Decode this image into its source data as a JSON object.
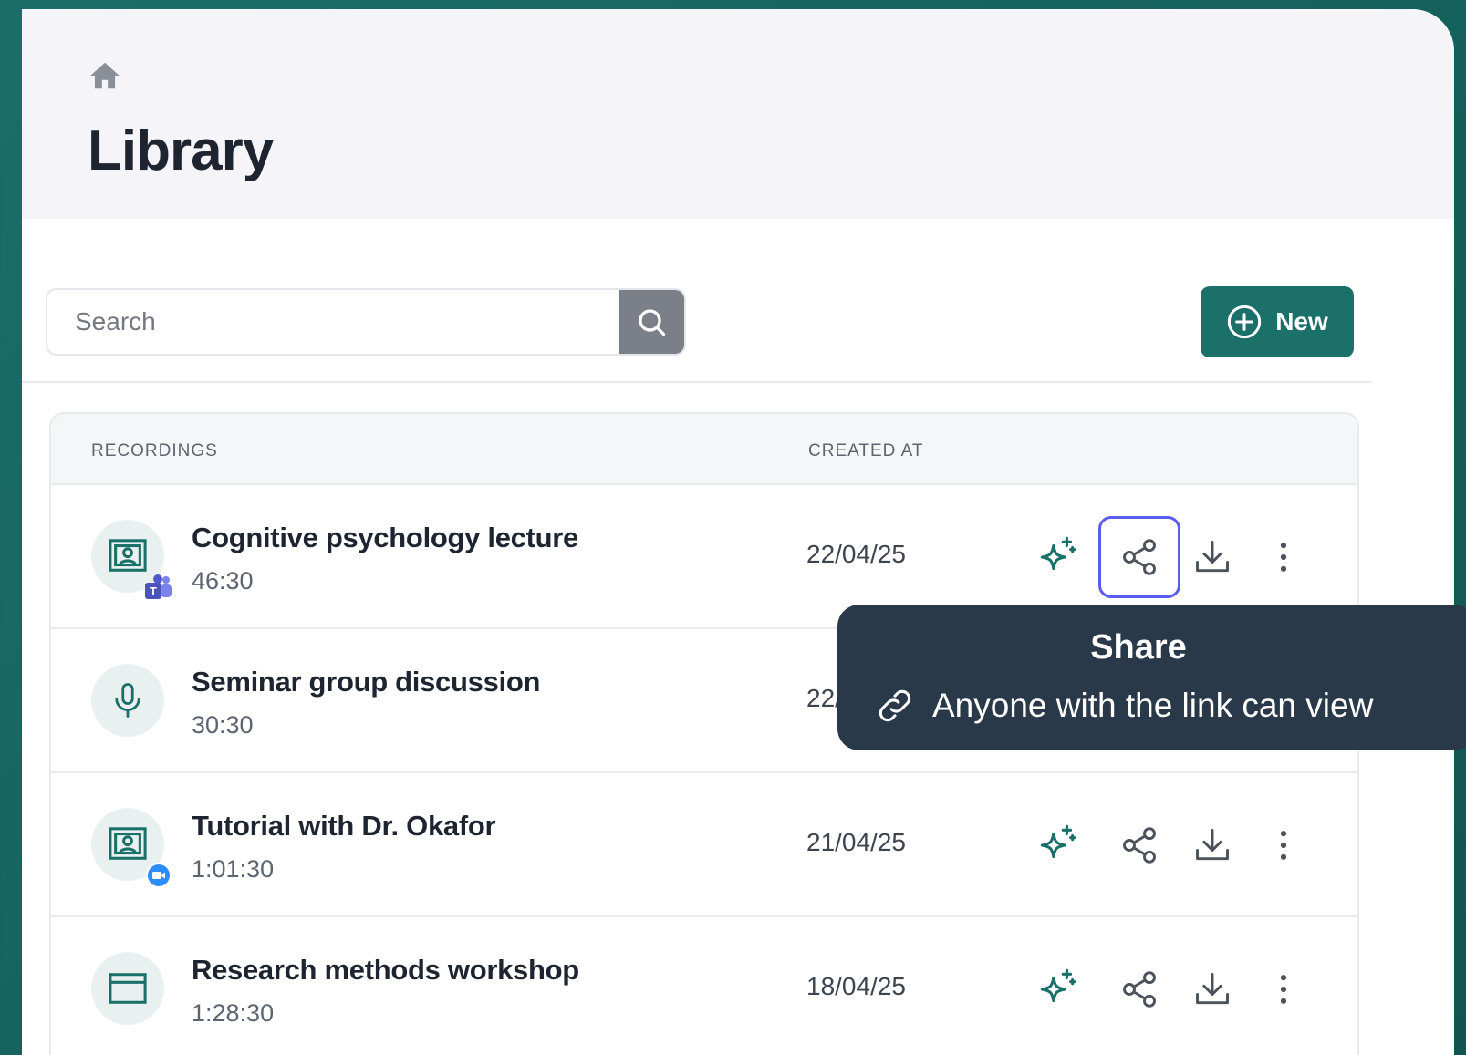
{
  "header": {
    "title": "Library"
  },
  "search": {
    "placeholder": "Search"
  },
  "toolbar": {
    "new_label": "New"
  },
  "table": {
    "columns": {
      "recordings": "RECORDINGS",
      "created_at": "CREATED AT"
    },
    "rows": [
      {
        "title": "Cognitive psychology lecture",
        "duration": "46:30",
        "date": "22/04/25",
        "icon": "presentation-icon",
        "badge": "teams-icon"
      },
      {
        "title": "Seminar group discussion",
        "duration": "30:30",
        "date": "22/04/25",
        "icon": "microphone-icon",
        "badge": ""
      },
      {
        "title": "Tutorial with Dr. Okafor",
        "duration": "1:01:30",
        "date": "21/04/25",
        "icon": "presentation-icon",
        "badge": "zoom-icon"
      },
      {
        "title": "Research methods workshop",
        "duration": "1:28:30",
        "date": "18/04/25",
        "icon": "window-icon",
        "badge": ""
      }
    ]
  },
  "tooltip": {
    "title": "Share",
    "subtitle": "Anyone with the link can view"
  },
  "colors": {
    "accent": "#1b7069",
    "focus": "#5a5cf0",
    "tooltip_bg": "#29394a"
  }
}
